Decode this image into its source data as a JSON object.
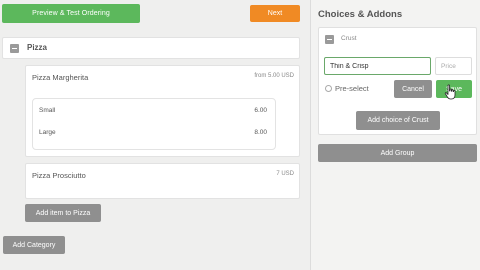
{
  "toolbar": {
    "preview_label": "Preview & Test Ordering",
    "next_label": "Next"
  },
  "category": {
    "name": "Pizza",
    "items": [
      {
        "name": "Pizza Margherita",
        "price": "from 5.00 USD",
        "sizes": [
          {
            "label": "Small",
            "price": "6.00"
          },
          {
            "label": "Large",
            "price": "8.00"
          }
        ]
      },
      {
        "name": "Pizza Prosciutto",
        "price": "7 USD"
      }
    ],
    "add_item_label": "Add item to Pizza"
  },
  "add_category_label": "Add Category",
  "panel": {
    "title": "Choices & Addons",
    "group": {
      "name": "Crust",
      "choice_value": "Thin & Crisp",
      "price_placeholder": "Price",
      "preselect_label": "Pre-select",
      "cancel_label": "Cancel",
      "save_label": "Save",
      "add_choice_label": "Add choice of Crust"
    },
    "add_group_label": "Add Group"
  },
  "colors": {
    "green": "#5cb85c",
    "orange": "#f08a24",
    "gray_button": "#8f8f8f"
  }
}
